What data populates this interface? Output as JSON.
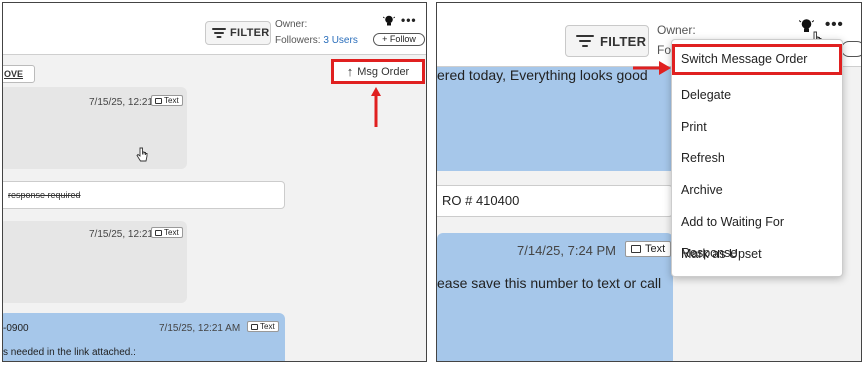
{
  "left": {
    "header": {
      "filter_label": "FILTER",
      "owner_label": "Owner:",
      "followers_label": "Followers:",
      "followers_link": "3 Users",
      "follow_button": "+ Follow",
      "more_label": "•••"
    },
    "move_label": "OVE",
    "msg_order_label": "Msg Order",
    "messages": [
      {
        "timestamp": "7/15/25, 12:21 AM",
        "tag": "Text"
      },
      {
        "timestamp": "7/15/25, 12:21 AM",
        "tag": "Text"
      },
      {
        "timestamp": "7/15/25, 12:21 AM",
        "tag": "Text",
        "prefix": "-0900",
        "body": "s needed in the link attached.:"
      }
    ],
    "note_text": "response required"
  },
  "right": {
    "header": {
      "filter_label": "FILTER",
      "owner_label": "Owner:",
      "followers_partial": "Fo",
      "more_label": "•••"
    },
    "top_text": "ered today, Everything looks good",
    "card_text": "RO # 410400",
    "message_timestamp": "7/14/25, 7:24 PM",
    "message_tag": "Text",
    "message_body": "ease save this number to text or call",
    "menu_items": [
      "Switch Message Order",
      "Delegate",
      "Print",
      "Refresh",
      "Archive",
      "Add to Waiting For Response",
      "Mark as Upset"
    ]
  },
  "colors": {
    "annotation_red": "#e02020",
    "bubble_blue": "#a6c7ea",
    "bubble_grey": "#e6e6e6",
    "link_blue": "#2a6ebb"
  }
}
